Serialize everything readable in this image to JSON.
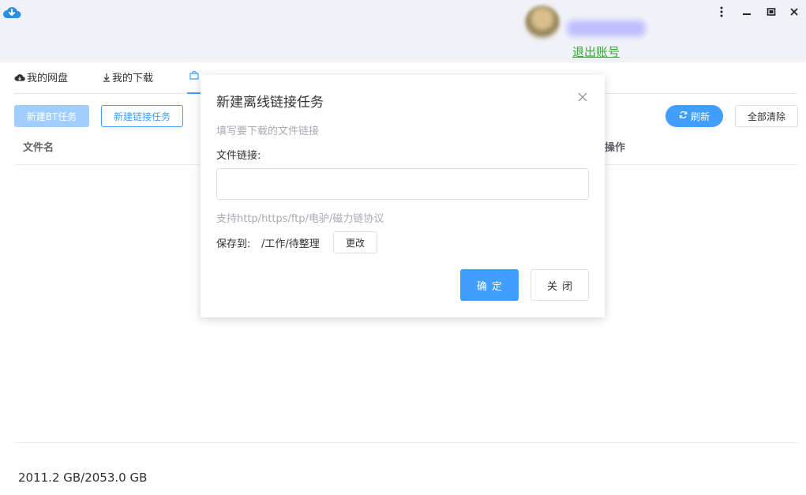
{
  "header": {
    "logout_label": "退出账号"
  },
  "window_controls": {
    "more_icon": "more-vertical-icon",
    "minimize_icon": "minimize-icon",
    "restore_icon": "restore-icon",
    "close_icon": "close-icon"
  },
  "tabs": [
    {
      "label": "我的网盘",
      "icon": "cloud-icon"
    },
    {
      "label": "我的下载",
      "icon": "download-arrow-icon"
    },
    {
      "label": "",
      "icon": "offline-icon",
      "active": true
    }
  ],
  "toolbar": {
    "new_bt_label": "新建BT任务",
    "new_link_label": "新建链接任务",
    "refresh_label": "刷新",
    "clear_all_label": "全部清除"
  },
  "table": {
    "columns": [
      "文件名",
      "操作"
    ]
  },
  "footer": {
    "storage": "2011.2 GB/2053.0 GB"
  },
  "modal": {
    "title": "新建离线链接任务",
    "hint": "填写要下载的文件链接",
    "link_label": "文件链接:",
    "link_value": "",
    "protocols": "支持http/https/ftp/电驴/磁力链协议",
    "save_label": "保存到:",
    "save_path": "/工作/待整理",
    "change_label": "更改",
    "confirm_label": "确定",
    "close_label": "关闭"
  },
  "colors": {
    "primary": "#409eff",
    "primary_light": "#a0cfff",
    "link_green": "#3aa33a",
    "header_bg": "#f1f2f7"
  }
}
